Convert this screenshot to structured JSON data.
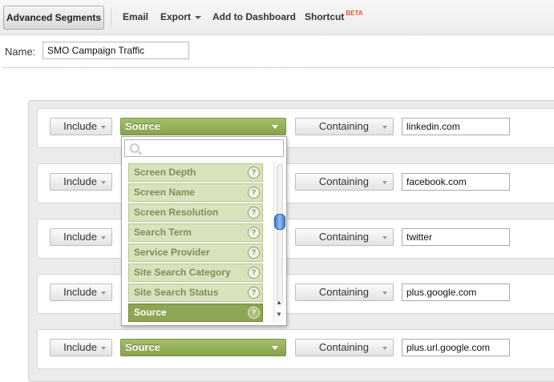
{
  "toolbar": {
    "advanced_segments": "Advanced Segments",
    "email": "Email",
    "export": "Export",
    "add_to_dashboard": "Add to Dashboard",
    "shortcut": "Shortcut",
    "beta": "BETA"
  },
  "name": {
    "label": "Name:",
    "value": "SMO Campaign Traffic"
  },
  "rows": [
    {
      "include": "Include",
      "field": "Source",
      "match": "Containing",
      "value": "linkedin.com"
    },
    {
      "include": "Include",
      "field": "",
      "match": "Containing",
      "value": "facebook.com"
    },
    {
      "include": "Include",
      "field": "",
      "match": "Containing",
      "value": "twitter"
    },
    {
      "include": "Include",
      "field": "",
      "match": "Containing",
      "value": "plus.google.com"
    },
    {
      "include": "Include",
      "field": "Source",
      "match": "Containing",
      "value": "plus.url.google.com"
    }
  ],
  "dropdown": {
    "search_placeholder": "",
    "items": [
      {
        "label": "Screen Depth"
      },
      {
        "label": "Screen Name"
      },
      {
        "label": "Screen Resolution"
      },
      {
        "label": "Search Term"
      },
      {
        "label": "Service Provider"
      },
      {
        "label": "Site Search Category"
      },
      {
        "label": "Site Search Status"
      },
      {
        "label": "Source",
        "selected": true
      }
    ],
    "help_glyph": "?",
    "scroll_up": "▲",
    "scroll_down": "▼"
  },
  "colors": {
    "field_green": "#8da653",
    "item_green": "#d8e3bd",
    "beta_orange": "#e05a2a"
  }
}
